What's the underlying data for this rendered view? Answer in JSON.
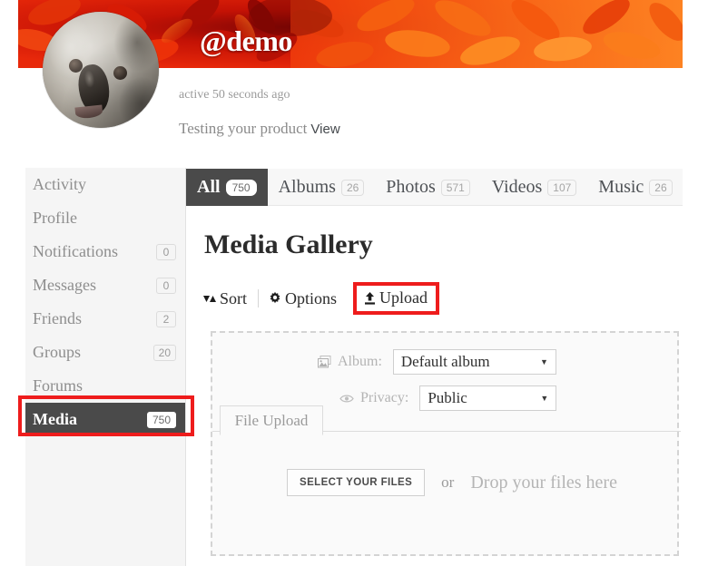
{
  "profile": {
    "username": "@demo",
    "active_status": "active 50 seconds ago",
    "bio": "Testing your product",
    "view_link": "View",
    "avatar_alt": "koala-avatar",
    "cover_alt": "red-orange-flower-cover"
  },
  "sidebar": {
    "items": [
      {
        "label": "Activity",
        "count": ""
      },
      {
        "label": "Profile",
        "count": ""
      },
      {
        "label": "Notifications",
        "count": "0"
      },
      {
        "label": "Messages",
        "count": "0"
      },
      {
        "label": "Friends",
        "count": "2"
      },
      {
        "label": "Groups",
        "count": "20"
      },
      {
        "label": "Forums",
        "count": ""
      },
      {
        "label": "Media",
        "count": "750"
      }
    ]
  },
  "tabs": [
    {
      "label": "All",
      "count": "750",
      "active": true
    },
    {
      "label": "Albums",
      "count": "26",
      "active": false
    },
    {
      "label": "Photos",
      "count": "571",
      "active": false
    },
    {
      "label": "Videos",
      "count": "107",
      "active": false
    },
    {
      "label": "Music",
      "count": "26",
      "active": false
    }
  ],
  "main": {
    "page_title": "Media Gallery",
    "toolbar": {
      "sort_label": "Sort",
      "sort_icon": "sort-arrows-icon",
      "options_label": "Options",
      "options_icon": "gear-icon",
      "upload_label": "Upload",
      "upload_icon": "upload-icon"
    },
    "upload_panel": {
      "album_label": "Album:",
      "album_icon": "images-stack-icon",
      "album_value": "Default album",
      "privacy_label": "Privacy:",
      "privacy_icon": "eye-icon",
      "privacy_value": "Public",
      "file_tab_label": "File Upload",
      "select_files_label": "SELECT YOUR FILES",
      "or_label": "or",
      "drop_label": "Drop your files here"
    }
  },
  "colors": {
    "highlight_red": "#ee1c1c",
    "active_dark": "#4a4a4a",
    "sidebar_bg": "#f5f5f5",
    "tabbar_bg": "#f7f7f7",
    "panel_bg": "#fafafa",
    "dashed_border": "#d4d4d4",
    "muted_text": "#9b9b9b"
  }
}
